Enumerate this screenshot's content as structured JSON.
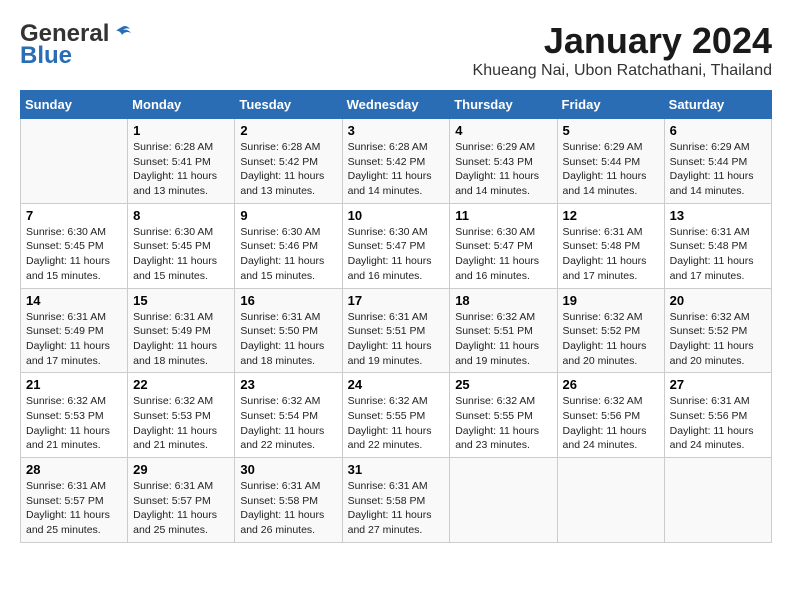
{
  "header": {
    "logo_general": "General",
    "logo_blue": "Blue",
    "title": "January 2024",
    "subtitle": "Khueang Nai, Ubon Ratchathani, Thailand"
  },
  "weekdays": [
    "Sunday",
    "Monday",
    "Tuesday",
    "Wednesday",
    "Thursday",
    "Friday",
    "Saturday"
  ],
  "weeks": [
    [
      {
        "day": "",
        "content": ""
      },
      {
        "day": "1",
        "content": "Sunrise: 6:28 AM\nSunset: 5:41 PM\nDaylight: 11 hours\nand 13 minutes."
      },
      {
        "day": "2",
        "content": "Sunrise: 6:28 AM\nSunset: 5:42 PM\nDaylight: 11 hours\nand 13 minutes."
      },
      {
        "day": "3",
        "content": "Sunrise: 6:28 AM\nSunset: 5:42 PM\nDaylight: 11 hours\nand 14 minutes."
      },
      {
        "day": "4",
        "content": "Sunrise: 6:29 AM\nSunset: 5:43 PM\nDaylight: 11 hours\nand 14 minutes."
      },
      {
        "day": "5",
        "content": "Sunrise: 6:29 AM\nSunset: 5:44 PM\nDaylight: 11 hours\nand 14 minutes."
      },
      {
        "day": "6",
        "content": "Sunrise: 6:29 AM\nSunset: 5:44 PM\nDaylight: 11 hours\nand 14 minutes."
      }
    ],
    [
      {
        "day": "7",
        "content": "Sunrise: 6:30 AM\nSunset: 5:45 PM\nDaylight: 11 hours\nand 15 minutes."
      },
      {
        "day": "8",
        "content": "Sunrise: 6:30 AM\nSunset: 5:45 PM\nDaylight: 11 hours\nand 15 minutes."
      },
      {
        "day": "9",
        "content": "Sunrise: 6:30 AM\nSunset: 5:46 PM\nDaylight: 11 hours\nand 15 minutes."
      },
      {
        "day": "10",
        "content": "Sunrise: 6:30 AM\nSunset: 5:47 PM\nDaylight: 11 hours\nand 16 minutes."
      },
      {
        "day": "11",
        "content": "Sunrise: 6:30 AM\nSunset: 5:47 PM\nDaylight: 11 hours\nand 16 minutes."
      },
      {
        "day": "12",
        "content": "Sunrise: 6:31 AM\nSunset: 5:48 PM\nDaylight: 11 hours\nand 17 minutes."
      },
      {
        "day": "13",
        "content": "Sunrise: 6:31 AM\nSunset: 5:48 PM\nDaylight: 11 hours\nand 17 minutes."
      }
    ],
    [
      {
        "day": "14",
        "content": "Sunrise: 6:31 AM\nSunset: 5:49 PM\nDaylight: 11 hours\nand 17 minutes."
      },
      {
        "day": "15",
        "content": "Sunrise: 6:31 AM\nSunset: 5:49 PM\nDaylight: 11 hours\nand 18 minutes."
      },
      {
        "day": "16",
        "content": "Sunrise: 6:31 AM\nSunset: 5:50 PM\nDaylight: 11 hours\nand 18 minutes."
      },
      {
        "day": "17",
        "content": "Sunrise: 6:31 AM\nSunset: 5:51 PM\nDaylight: 11 hours\nand 19 minutes."
      },
      {
        "day": "18",
        "content": "Sunrise: 6:32 AM\nSunset: 5:51 PM\nDaylight: 11 hours\nand 19 minutes."
      },
      {
        "day": "19",
        "content": "Sunrise: 6:32 AM\nSunset: 5:52 PM\nDaylight: 11 hours\nand 20 minutes."
      },
      {
        "day": "20",
        "content": "Sunrise: 6:32 AM\nSunset: 5:52 PM\nDaylight: 11 hours\nand 20 minutes."
      }
    ],
    [
      {
        "day": "21",
        "content": "Sunrise: 6:32 AM\nSunset: 5:53 PM\nDaylight: 11 hours\nand 21 minutes."
      },
      {
        "day": "22",
        "content": "Sunrise: 6:32 AM\nSunset: 5:53 PM\nDaylight: 11 hours\nand 21 minutes."
      },
      {
        "day": "23",
        "content": "Sunrise: 6:32 AM\nSunset: 5:54 PM\nDaylight: 11 hours\nand 22 minutes."
      },
      {
        "day": "24",
        "content": "Sunrise: 6:32 AM\nSunset: 5:55 PM\nDaylight: 11 hours\nand 22 minutes."
      },
      {
        "day": "25",
        "content": "Sunrise: 6:32 AM\nSunset: 5:55 PM\nDaylight: 11 hours\nand 23 minutes."
      },
      {
        "day": "26",
        "content": "Sunrise: 6:32 AM\nSunset: 5:56 PM\nDaylight: 11 hours\nand 24 minutes."
      },
      {
        "day": "27",
        "content": "Sunrise: 6:31 AM\nSunset: 5:56 PM\nDaylight: 11 hours\nand 24 minutes."
      }
    ],
    [
      {
        "day": "28",
        "content": "Sunrise: 6:31 AM\nSunset: 5:57 PM\nDaylight: 11 hours\nand 25 minutes."
      },
      {
        "day": "29",
        "content": "Sunrise: 6:31 AM\nSunset: 5:57 PM\nDaylight: 11 hours\nand 25 minutes."
      },
      {
        "day": "30",
        "content": "Sunrise: 6:31 AM\nSunset: 5:58 PM\nDaylight: 11 hours\nand 26 minutes."
      },
      {
        "day": "31",
        "content": "Sunrise: 6:31 AM\nSunset: 5:58 PM\nDaylight: 11 hours\nand 27 minutes."
      },
      {
        "day": "",
        "content": ""
      },
      {
        "day": "",
        "content": ""
      },
      {
        "day": "",
        "content": ""
      }
    ]
  ]
}
